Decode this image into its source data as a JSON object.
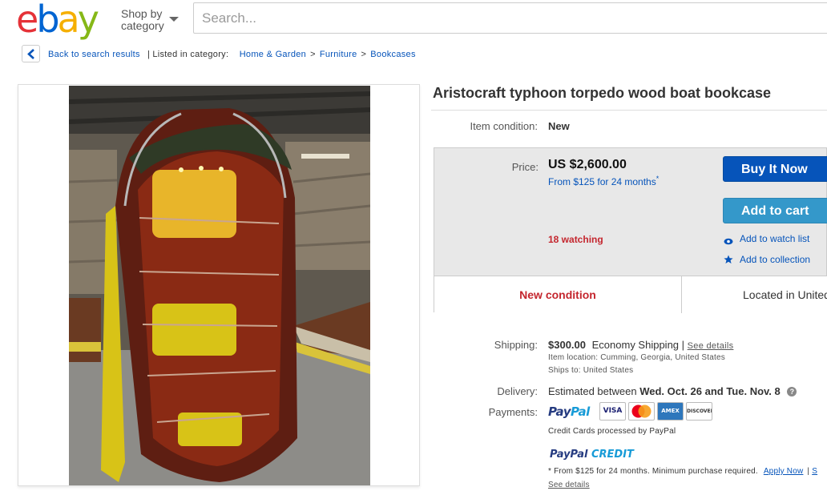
{
  "header": {
    "logo": {
      "e": "e",
      "b": "b",
      "a": "a",
      "y": "y"
    },
    "shop_by_line1": "Shop by",
    "shop_by_line2": "category",
    "search_placeholder": "Search..."
  },
  "breadcrumb": {
    "back_label": "Back to search results",
    "divider": "|",
    "listed_in": "Listed in category:",
    "items": [
      "Home & Garden",
      "Furniture",
      "Bookcases"
    ],
    "separator": ">"
  },
  "listing": {
    "title": "Aristocraft typhoon torpedo wood boat bookcase",
    "condition_label": "Item condition:",
    "condition_value": "New",
    "price_label": "Price:",
    "price": "US $2,600.00",
    "finance": "From $125 for 24 months",
    "finance_mark": "*",
    "watching": "18 watching",
    "buy_now": "Buy It Now",
    "add_to_cart": "Add to cart",
    "watch_list": "Add to watch list",
    "collection": "Add to collection",
    "new_condition": "New condition",
    "located": "Located in United States"
  },
  "shipping": {
    "label": "Shipping:",
    "cost": "$300.00",
    "method": "Economy Shipping",
    "sep": "|",
    "see_details": "See details",
    "location_label": "Item location:",
    "location": "Cumming, Georgia, United States",
    "ships_to_label": "Ships to:",
    "ships_to": "United States"
  },
  "delivery": {
    "label": "Delivery:",
    "prefix": "Estimated between",
    "range": "Wed. Oct. 26 and Tue. Nov. 8",
    "help": "?"
  },
  "payments": {
    "label": "Payments:",
    "paypal_pay": "Pay",
    "paypal_pal": "Pal",
    "cards": [
      "VISA",
      "MC",
      "AMEX",
      "DISCOVER"
    ],
    "cc_note": "Credit Cards processed by PayPal",
    "credit_pay": "PayPal",
    "credit_word": "CREDIT",
    "credit_note": "* From $125 for 24 months. Minimum purchase required.",
    "apply_now": "Apply Now",
    "pipe": "|",
    "trailing": "S",
    "see_details": "See details"
  },
  "colors": {
    "logo_e": "#e53238",
    "logo_b": "#0064d2",
    "logo_a": "#f5af02",
    "logo_y": "#86b817",
    "link": "#0654ba",
    "alert": "#c4262e",
    "buy_button": "#0654ba",
    "cart_button": "#3498ca"
  }
}
